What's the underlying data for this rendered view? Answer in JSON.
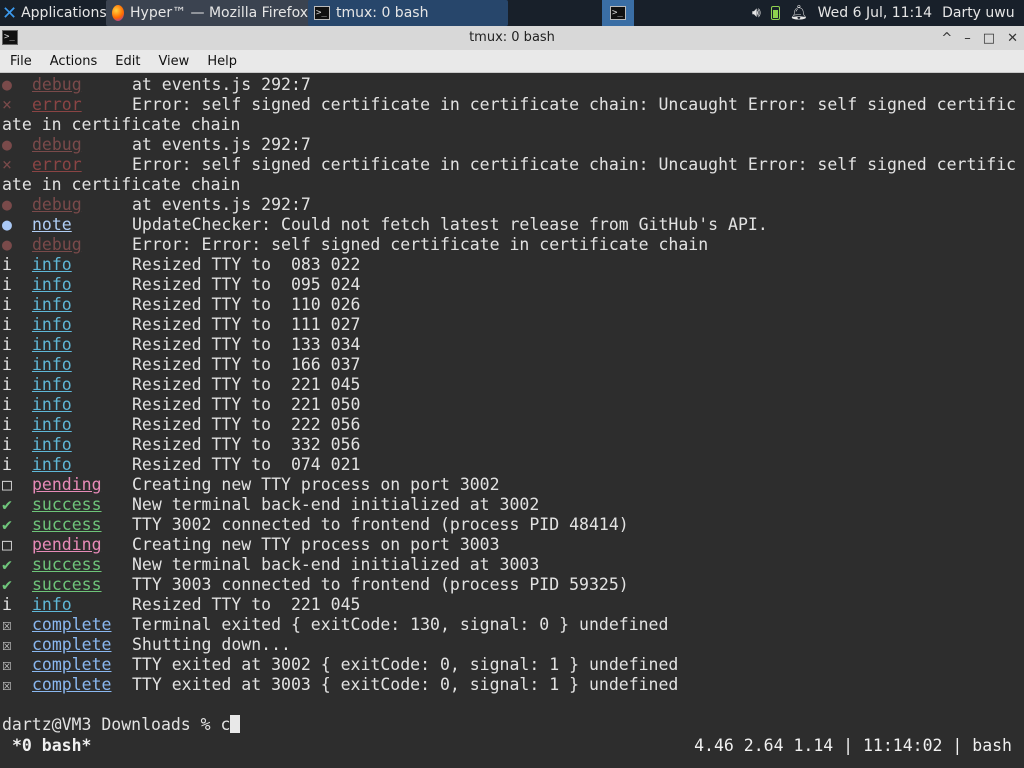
{
  "panel": {
    "applications_label": "Applications",
    "tasks": [
      {
        "label": "Hyper™ — Mozilla Firefox"
      },
      {
        "label": "tmux: 0 bash"
      }
    ],
    "datetime": "Wed  6 Jul, 11:14",
    "user": "Darty uwu"
  },
  "window": {
    "title": "tmux: 0 bash",
    "controls": {
      "restore": "^",
      "minimize": "–",
      "maximize": "□",
      "close": "✕"
    }
  },
  "menubar": {
    "items": [
      "File",
      "Actions",
      "Edit",
      "View",
      "Help"
    ]
  },
  "terminal": {
    "lines": [
      {
        "kind": "debug",
        "icon": "●",
        "level": "debug",
        "text": "at events.js 292:7"
      },
      {
        "kind": "error",
        "icon": "×",
        "level": "error",
        "text": "Error: self signed certificate in certificate chain: Uncaught Error: self signed certific"
      },
      {
        "kind": "cont",
        "text": "ate in certificate chain"
      },
      {
        "kind": "debug",
        "icon": "●",
        "level": "debug",
        "text": "at events.js 292:7"
      },
      {
        "kind": "error",
        "icon": "×",
        "level": "error",
        "text": "Error: self signed certificate in certificate chain: Uncaught Error: self signed certific"
      },
      {
        "kind": "cont",
        "text": "ate in certificate chain"
      },
      {
        "kind": "debug",
        "icon": "●",
        "level": "debug",
        "text": "at events.js 292:7"
      },
      {
        "kind": "note",
        "icon": "●",
        "level": "note",
        "text": "UpdateChecker: Could not fetch latest release from GitHub's API."
      },
      {
        "kind": "debug",
        "icon": "●",
        "level": "debug",
        "text": "Error: Error: self signed certificate in certificate chain"
      },
      {
        "kind": "info",
        "icon": "i",
        "level": "info",
        "text": "Resized TTY to  083 022"
      },
      {
        "kind": "info",
        "icon": "i",
        "level": "info",
        "text": "Resized TTY to  095 024"
      },
      {
        "kind": "info",
        "icon": "i",
        "level": "info",
        "text": "Resized TTY to  110 026"
      },
      {
        "kind": "info",
        "icon": "i",
        "level": "info",
        "text": "Resized TTY to  111 027"
      },
      {
        "kind": "info",
        "icon": "i",
        "level": "info",
        "text": "Resized TTY to  133 034"
      },
      {
        "kind": "info",
        "icon": "i",
        "level": "info",
        "text": "Resized TTY to  166 037"
      },
      {
        "kind": "info",
        "icon": "i",
        "level": "info",
        "text": "Resized TTY to  221 045"
      },
      {
        "kind": "info",
        "icon": "i",
        "level": "info",
        "text": "Resized TTY to  221 050"
      },
      {
        "kind": "info",
        "icon": "i",
        "level": "info",
        "text": "Resized TTY to  222 056"
      },
      {
        "kind": "info",
        "icon": "i",
        "level": "info",
        "text": "Resized TTY to  332 056"
      },
      {
        "kind": "info",
        "icon": "i",
        "level": "info",
        "text": "Resized TTY to  074 021"
      },
      {
        "kind": "pending",
        "icon": "□",
        "level": "pending",
        "text": "Creating new TTY process on port 3002"
      },
      {
        "kind": "success",
        "icon": "✔",
        "level": "success",
        "text": "New terminal back-end initialized at 3002"
      },
      {
        "kind": "success",
        "icon": "✔",
        "level": "success",
        "text": "TTY 3002 connected to frontend (process PID 48414)"
      },
      {
        "kind": "pending",
        "icon": "□",
        "level": "pending",
        "text": "Creating new TTY process on port 3003"
      },
      {
        "kind": "success",
        "icon": "✔",
        "level": "success",
        "text": "New terminal back-end initialized at 3003"
      },
      {
        "kind": "success",
        "icon": "✔",
        "level": "success",
        "text": "TTY 3003 connected to frontend (process PID 59325)"
      },
      {
        "kind": "info",
        "icon": "i",
        "level": "info",
        "text": "Resized TTY to  221 045"
      },
      {
        "kind": "complete",
        "icon": "☒",
        "level": "complete",
        "text": "Terminal exited { exitCode: 130, signal: 0 } undefined"
      },
      {
        "kind": "complete",
        "icon": "☒",
        "level": "complete",
        "text": "Shutting down..."
      },
      {
        "kind": "complete",
        "icon": "☒",
        "level": "complete",
        "text": "TTY exited at 3002 { exitCode: 0, signal: 1 } undefined"
      },
      {
        "kind": "complete",
        "icon": "☒",
        "level": "complete",
        "text": "TTY exited at 3003 { exitCode: 0, signal: 1 } undefined"
      }
    ],
    "prompt": "dartz@VM3 Downloads % ",
    "input": "c"
  },
  "statusbar": {
    "window": "*0 bash*",
    "right": "4.46 2.64 1.14 | 11:14:02 | bash"
  }
}
